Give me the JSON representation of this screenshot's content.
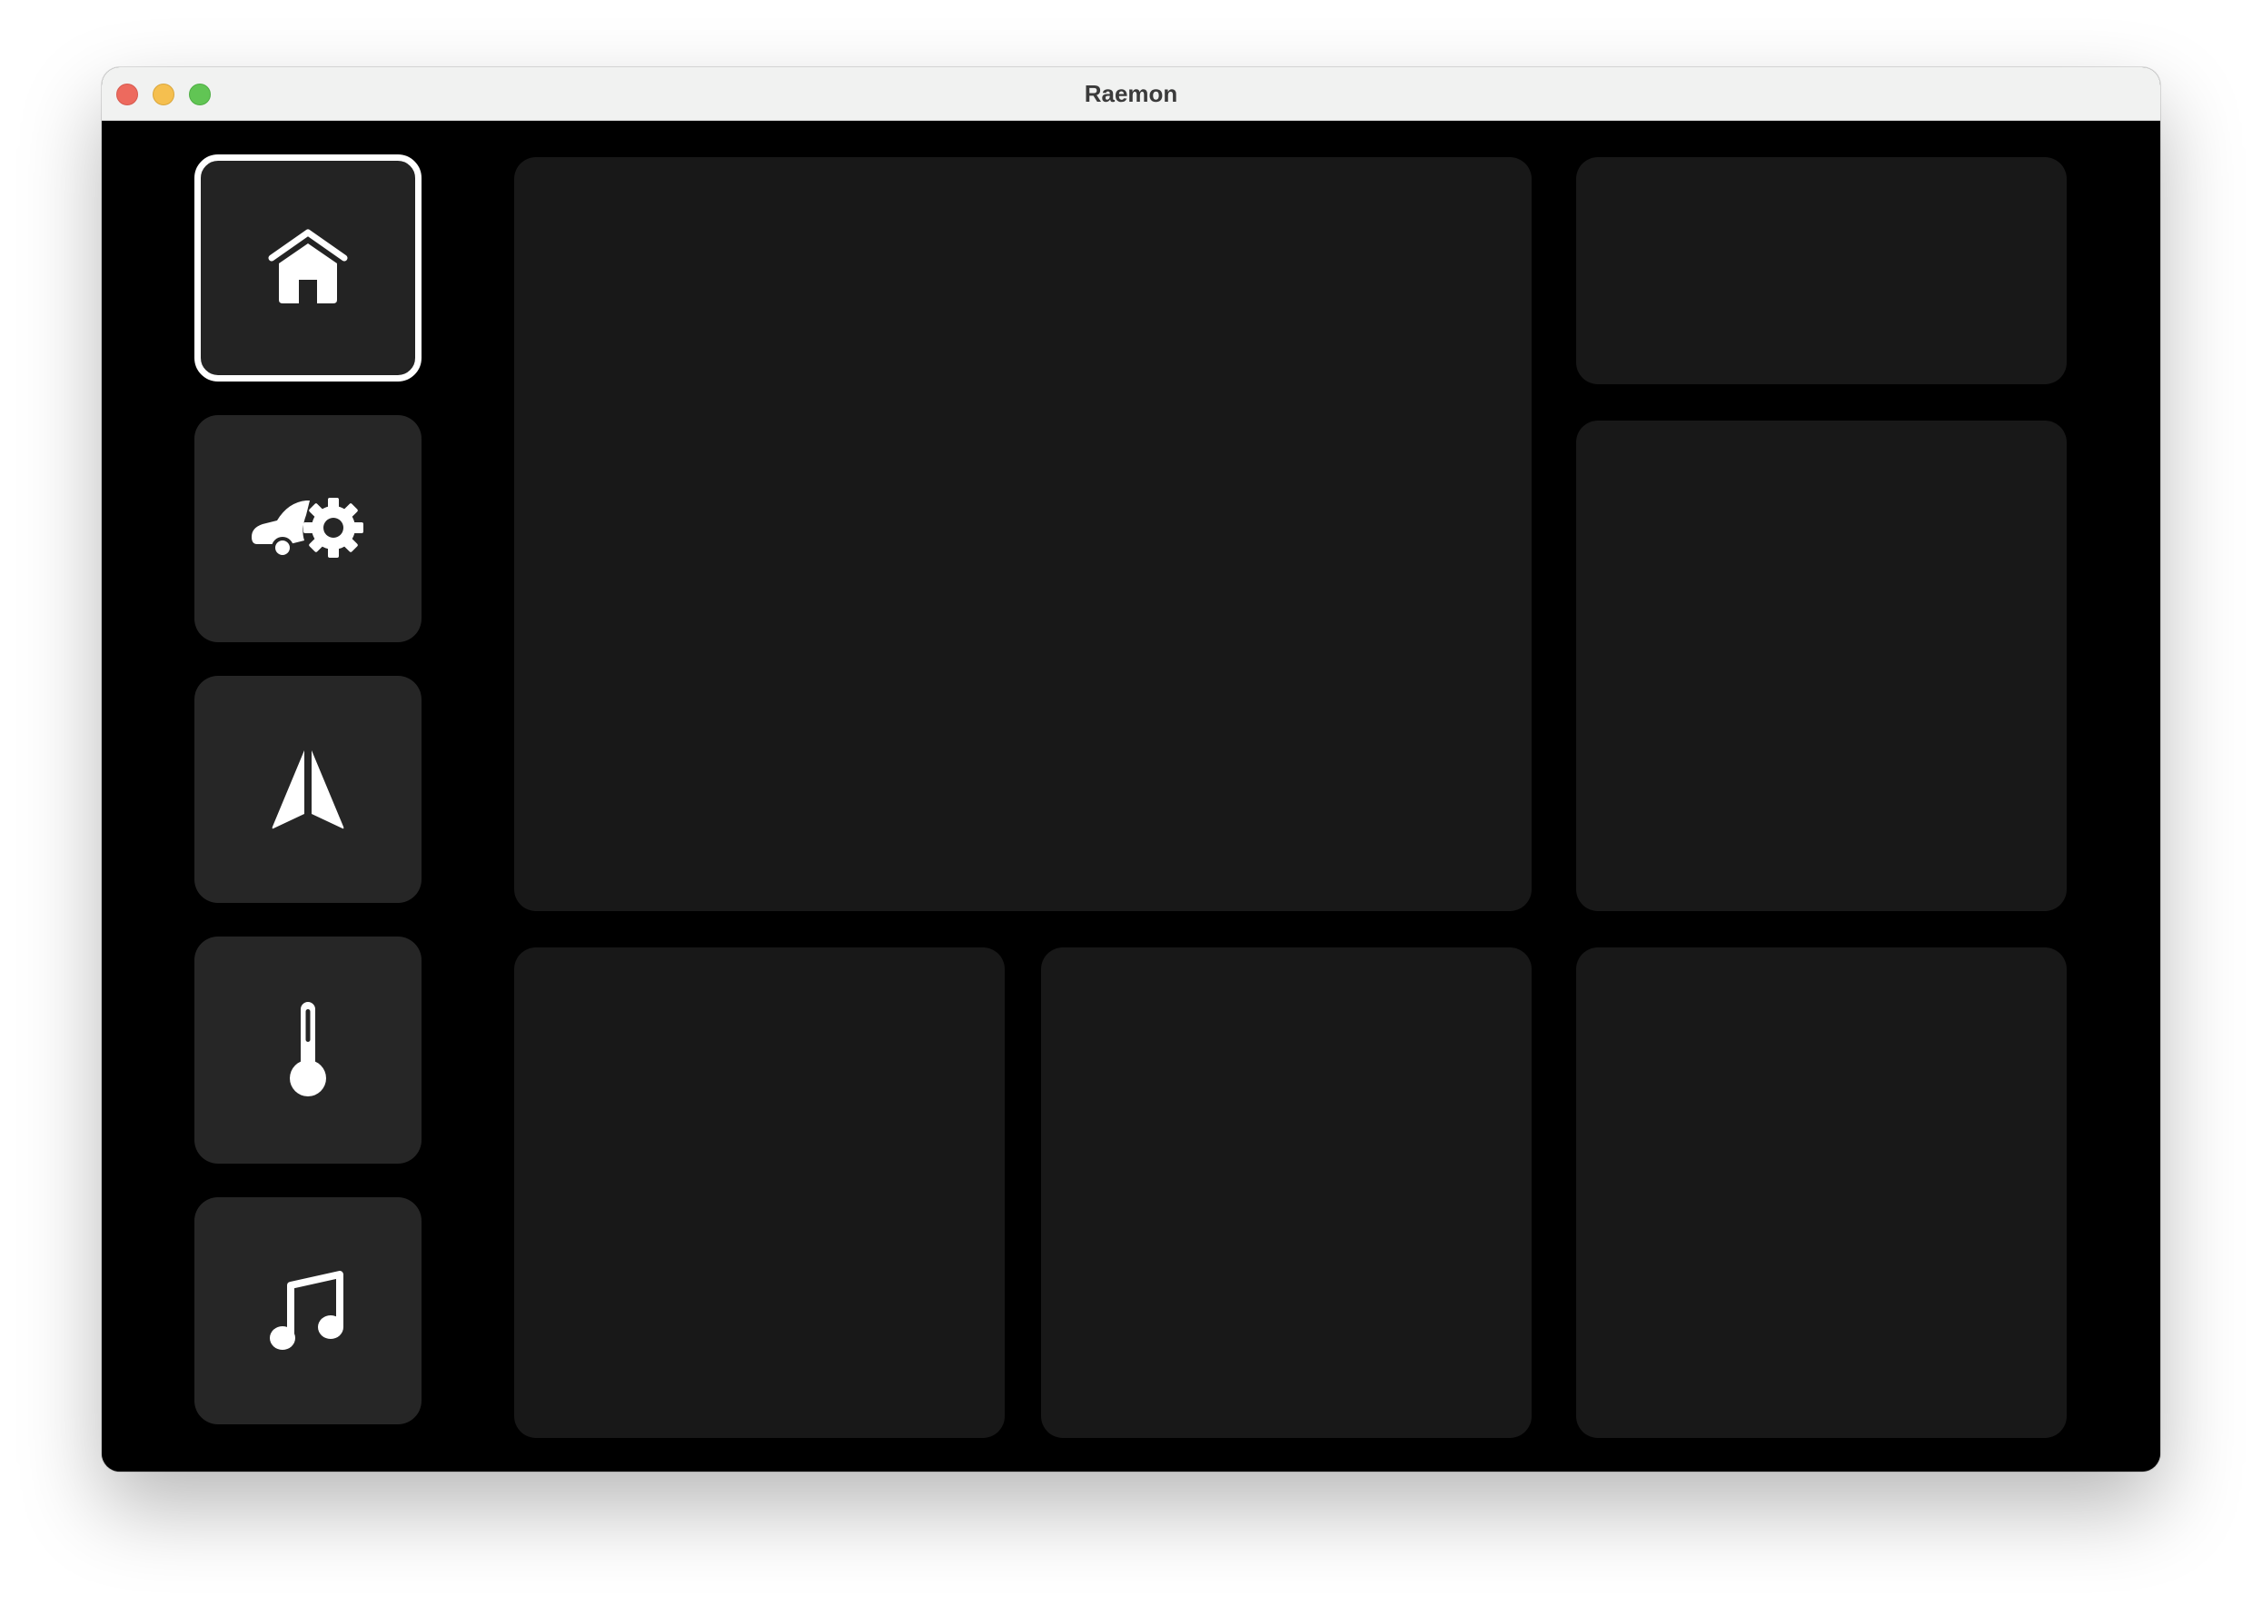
{
  "window": {
    "title": "Raemon"
  },
  "sidebar": {
    "items": [
      {
        "id": "home",
        "icon": "home-icon",
        "active": true
      },
      {
        "id": "vehicle-settings",
        "icon": "car-gear-icon",
        "active": false
      },
      {
        "id": "navigation",
        "icon": "navigation-arrow-icon",
        "active": false
      },
      {
        "id": "climate",
        "icon": "thermometer-icon",
        "active": false
      },
      {
        "id": "music",
        "icon": "music-note-icon",
        "active": false
      }
    ]
  },
  "colors": {
    "background": "#000000",
    "button": "#262626",
    "panel": "#181818",
    "active_border": "#ffffff",
    "titlebar": "#f1f2f1"
  }
}
